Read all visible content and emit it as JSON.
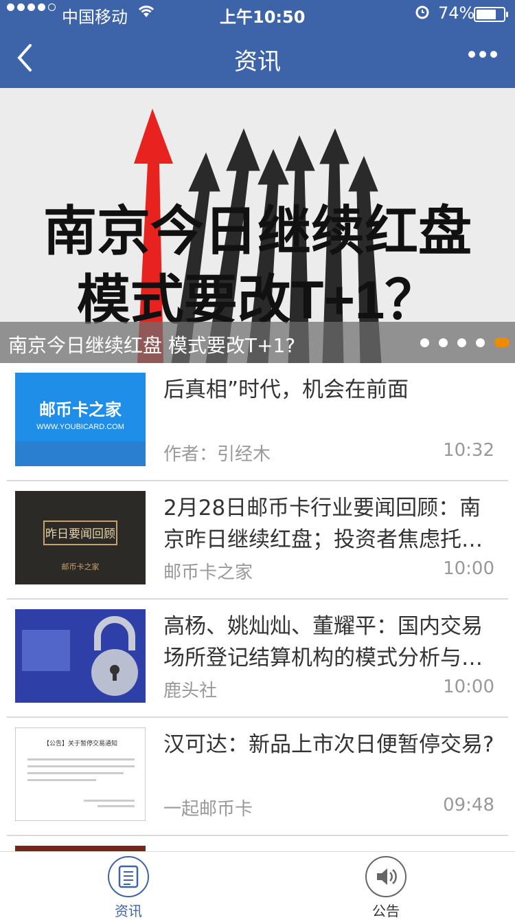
{
  "status_bar": {
    "carrier": "中国移动",
    "time": "上午10:50",
    "battery": "74%",
    "battery_level": 0.74
  },
  "nav": {
    "title": "资讯"
  },
  "banner": {
    "image_line1": "南京今日继续红盘",
    "image_line2": "模式要改T+1？",
    "caption": "南京今日继续红盘 模式要改T+1?",
    "slides": 5,
    "active_slide": 5
  },
  "news": [
    {
      "title": "后真相”时代，机会在前面",
      "source": "作者：引经木",
      "time": "10:32",
      "thumb_title": "邮币卡之家",
      "thumb_url": "WWW.YOUBICARD.COM"
    },
    {
      "title": "2月28日邮币卡行业要闻回顾：南京昨日继续红盘；投资者焦虑托…",
      "source": "邮币卡之家",
      "time": "10:00",
      "thumb_title": "昨日要闻回顾",
      "thumb_sub": "邮币卡之家"
    },
    {
      "title": "高杨、姚灿灿、董耀平：国内交易场所登记结算机构的模式分析与…",
      "source": "鹿头社",
      "time": "10:00"
    },
    {
      "title": "汉可达：新品上市次日便暂停交易?",
      "source": "一起邮币卡",
      "time": "09:48",
      "thumb_heading": "【公告】关于暂停交易通知"
    }
  ],
  "tabs": [
    {
      "label": "资讯",
      "icon": "document-list-icon",
      "active": true
    },
    {
      "label": "公告",
      "icon": "speaker-icon",
      "active": false
    }
  ],
  "colors": {
    "primary": "#3d64a8",
    "accent": "#f08a00"
  }
}
